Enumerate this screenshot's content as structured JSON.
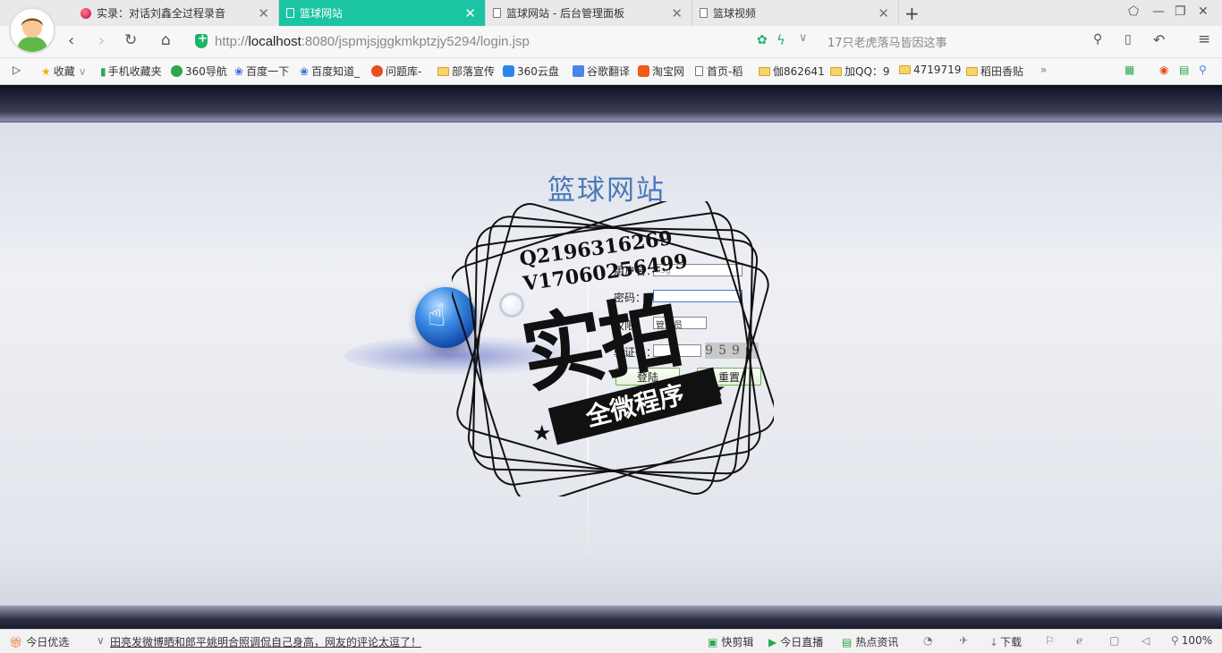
{
  "tabs": [
    {
      "title": "实录：对话刘鑫全过程录音",
      "active": false,
      "icon": "record-icon"
    },
    {
      "title": "篮球网站",
      "active": true,
      "icon": "document-icon"
    },
    {
      "title": "篮球网站 - 后台管理面板",
      "active": false,
      "icon": "document-icon"
    },
    {
      "title": "篮球视频",
      "active": false,
      "icon": "document-icon"
    }
  ],
  "nav": {
    "url_prefix": "http://",
    "url_host": "localhost",
    "url_rest": ":8080/jspmjsjggkmkptzjy5294/login.jsp",
    "search_text": "17只老虎落马皆因这事"
  },
  "bookmarks": [
    {
      "label": "收藏",
      "icon": "star-icon"
    },
    {
      "label": "手机收藏夹",
      "icon": "phone-icon"
    },
    {
      "label": "360导航",
      "icon": "360-icon"
    },
    {
      "label": "百度一下",
      "icon": "baidu-icon"
    },
    {
      "label": "百度知道_",
      "icon": "baidu-icon"
    },
    {
      "label": "问题库-",
      "icon": "sogou-icon"
    },
    {
      "label": "部落宣传",
      "icon": "folder-icon"
    },
    {
      "label": "360云盘",
      "icon": "cloud-icon"
    },
    {
      "label": "谷歌翻译",
      "icon": "translate-icon"
    },
    {
      "label": "淘宝网",
      "icon": "taobao-icon"
    },
    {
      "label": "首页-稻",
      "icon": "document-icon"
    },
    {
      "label": "伽862641",
      "icon": "folder-icon"
    },
    {
      "label": "加QQ：9",
      "icon": "folder-icon"
    },
    {
      "label": "4719719",
      "icon": "folder-icon"
    },
    {
      "label": "稻田香贴",
      "icon": "folder-icon"
    }
  ],
  "login": {
    "site_title": "篮球网站",
    "username_label": "用户名：",
    "username_value": "lisg",
    "password_label": "密码：",
    "role_label": "权限：",
    "role_value": "管理员",
    "captcha_label": "验证码：",
    "captcha_value": "9590",
    "login_button": "登陆",
    "reset_button": "重置"
  },
  "watermark": {
    "line1": "Q2196316269",
    "line2": "V17060256499",
    "big_text": "实拍",
    "ribbon_text": "全微程序"
  },
  "status": {
    "today_pick": "今日优选",
    "news": "田亮发微博晒和郎平姚明合照调侃自己身高，网友的评论太逗了！",
    "quick_cut": "快剪辑",
    "live": "今日直播",
    "hot_news": "热点资讯",
    "download": "下载",
    "zoom": "100%"
  },
  "colors": {
    "active_tab": "#1bc4a2",
    "site_title": "#4a79b8"
  }
}
